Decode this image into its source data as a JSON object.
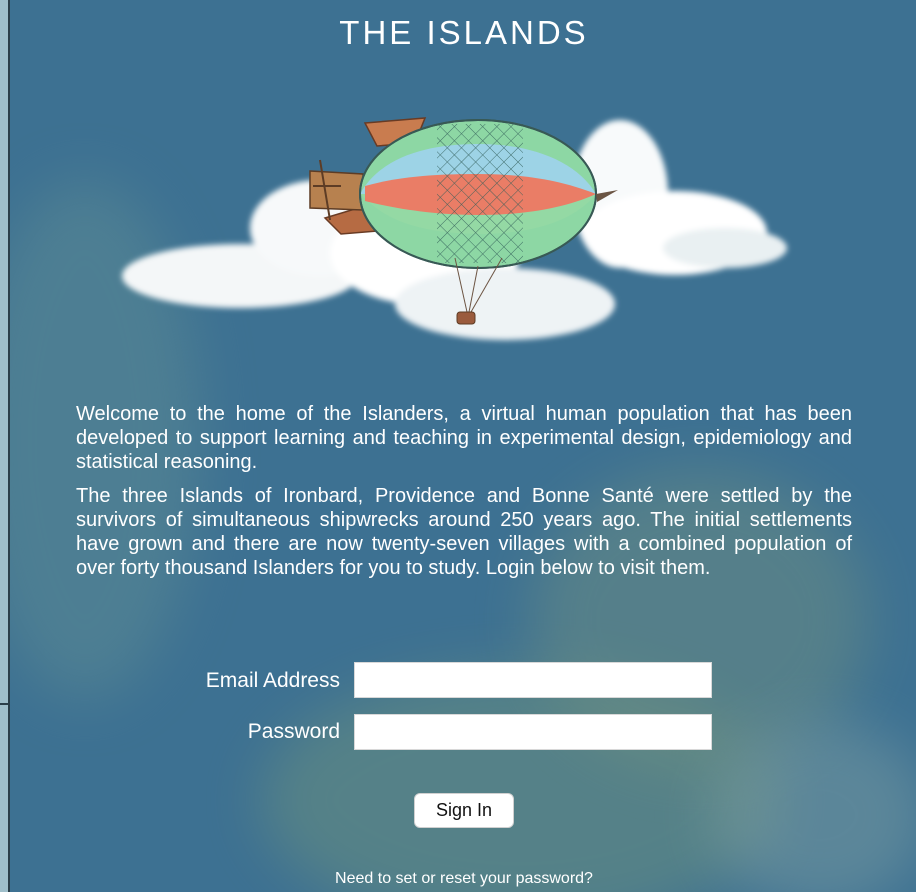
{
  "header": {
    "title": "THE ISLANDS"
  },
  "hero": {
    "icon": "airship-cloud-illustration"
  },
  "intro": {
    "paragraph_1": "Welcome to the home of the Islanders, a virtual human population that has been developed to support learning and teaching in experimental design, epidemiology and statistical reasoning.",
    "paragraph_2": "The three Islands of Ironbard, Providence and Bonne Santé were settled by the survivors of simultaneous shipwrecks around 250 years ago. The initial settlements have grown and there are now twenty-seven villages with a combined population of over forty thousand Islanders for you to study. Login below to visit them."
  },
  "login": {
    "email_label": "Email Address",
    "email_value": "",
    "password_label": "Password",
    "password_value": "",
    "sign_in_label": "Sign In",
    "reset_link": "Need to set or reset your password?"
  },
  "colors": {
    "background": "#3d7192",
    "text": "#ffffff"
  }
}
